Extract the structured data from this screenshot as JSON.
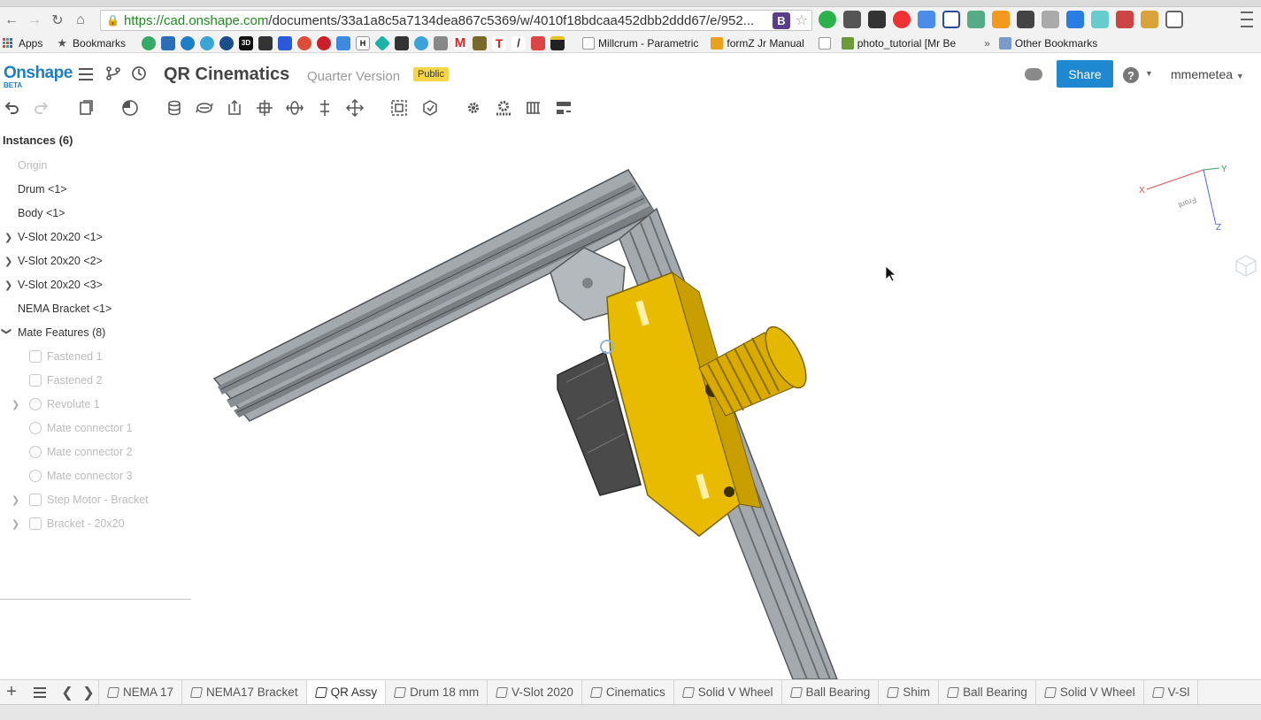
{
  "browser": {
    "url_scheme": "https://",
    "url_host": "cad.onshape.com",
    "url_path": "/documents/33a1a8c5a7134dea867c5369/w/4010f18bdcaa452dbb2ddd67/e/952...",
    "omnibox_ext_label": "B",
    "bookmarks": {
      "apps": "Apps",
      "bookmarks": "Bookmarks",
      "b3d": "3D",
      "bh": "H",
      "bm": "M",
      "millcrum": "Millcrum - Parametric",
      "formz": "formZ Jr Manual",
      "photo": "photo_tutorial [Mr Be",
      "overflow": "»",
      "other": "Other Bookmarks"
    }
  },
  "header": {
    "logo": "Onshape",
    "logo_sub": "BETA",
    "doc_title": "QR Cinematics",
    "doc_version": "Quarter Version",
    "visibility_badge": "Public",
    "share_label": "Share",
    "help_label": "?",
    "user_name": "mmemetea"
  },
  "feature_tree": {
    "title": "Instances (6)",
    "items": [
      {
        "label": "Origin"
      },
      {
        "label": "Drum <1>"
      },
      {
        "label": "Body <1>"
      },
      {
        "label": "V-Slot 20x20 <1>"
      },
      {
        "label": "V-Slot 20x20 <2>"
      },
      {
        "label": "V-Slot 20x20 <3>"
      },
      {
        "label": "NEMA Bracket <1>"
      },
      {
        "label": "Mate Features (8)"
      },
      {
        "label": "Fastened 1"
      },
      {
        "label": "Fastened 2"
      },
      {
        "label": "Revolute 1"
      },
      {
        "label": "Mate connector 1"
      },
      {
        "label": "Mate connector 2"
      },
      {
        "label": "Mate connector 3"
      },
      {
        "label": "Step Motor - Bracket"
      },
      {
        "label": "Bracket - 20x20"
      }
    ]
  },
  "triad": {
    "x_label": "X",
    "y_label": "Y",
    "z_label": "Z",
    "face_label": "Front",
    "x_color": "#e05050",
    "y_color": "#3aa35a",
    "z_color": "#4a66d8"
  },
  "tabs": [
    {
      "label": "NEMA 17"
    },
    {
      "label": "NEMA17 Bracket"
    },
    {
      "label": "QR Assy"
    },
    {
      "label": "Drum 18 mm"
    },
    {
      "label": "V-Slot 2020"
    },
    {
      "label": "Cinematics"
    },
    {
      "label": "Solid V Wheel"
    },
    {
      "label": "Ball Bearing"
    },
    {
      "label": "Shim"
    },
    {
      "label": "Ball Bearing"
    },
    {
      "label": "Solid V Wheel"
    },
    {
      "label": "V-Sl"
    }
  ],
  "colors": {
    "accent": "#1e88d0",
    "badge": "#f5d547",
    "part_yellow": "#e5b800",
    "extrusion_gray": "#9aa0a6",
    "motor_dark": "#4a4a4a"
  }
}
